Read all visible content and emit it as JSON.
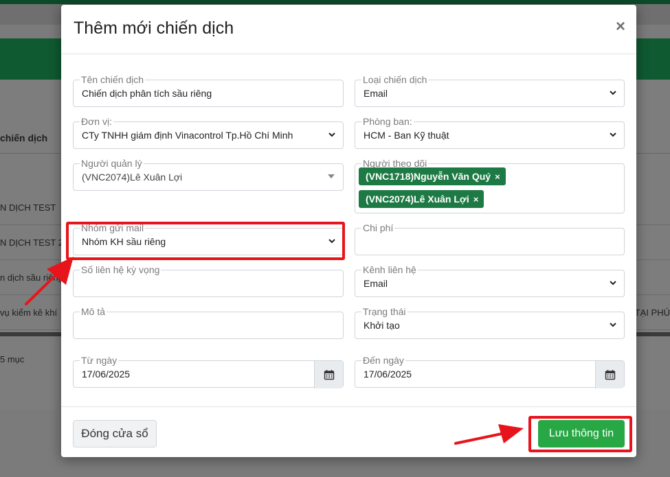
{
  "background": {
    "table_header": "chiến dịch",
    "rows": [
      "N DỊCH TEST",
      "N DỊCH TEST 2",
      "n dịch sầu riêng",
      "vụ kiểm kê khí"
    ],
    "row_right_text": "TẠI PHÚ",
    "footer_text": "5 mục"
  },
  "modal": {
    "title": "Thêm mới chiến dịch",
    "close_symbol": "×",
    "fields": {
      "campaign_name": {
        "label": "Tên chiến dịch",
        "value": "Chiến dịch phân tích sầu riêng"
      },
      "campaign_type": {
        "label": "Loại chiến dịch",
        "value": "Email"
      },
      "unit": {
        "label": "Đơn vị:",
        "value": "CTy TNHH giám định Vinacontrol Tp.Hồ Chí Minh"
      },
      "department": {
        "label": "Phòng ban:",
        "value": "HCM - Ban Kỹ thuật"
      },
      "manager": {
        "label": "Người quản lý",
        "value": "(VNC2074)Lê Xuân Lợi"
      },
      "followers": {
        "label": "Người theo dõi",
        "tags": [
          "(VNC1718)Nguyễn Văn Quý",
          "(VNC2074)Lê Xuân Lợi"
        ],
        "tag_remove": "×"
      },
      "mail_group": {
        "label": "Nhóm gửi mail",
        "value": "Nhóm KH sầu riêng"
      },
      "cost": {
        "label": "Chi phí",
        "value": ""
      },
      "expected_contacts": {
        "label": "Số liên hệ kỳ vọng",
        "value": ""
      },
      "contact_channel": {
        "label": "Kênh liên hệ",
        "value": "Email"
      },
      "description": {
        "label": "Mô tả",
        "value": ""
      },
      "status": {
        "label": "Trạng thái",
        "value": "Khởi tạo"
      },
      "from_date": {
        "label": "Từ ngày",
        "value": "17/06/2025"
      },
      "to_date": {
        "label": "Đến ngày",
        "value": "17/06/2025"
      }
    },
    "buttons": {
      "close": "Đóng cửa sổ",
      "save": "Lưu thông tin"
    }
  },
  "colors": {
    "tag": "#1e7a45",
    "save_button": "#28a745",
    "highlight": "#e8141b"
  },
  "icons": {
    "dropdown": "chevron-down-icon",
    "calendar": "calendar-icon",
    "close": "close-icon"
  }
}
